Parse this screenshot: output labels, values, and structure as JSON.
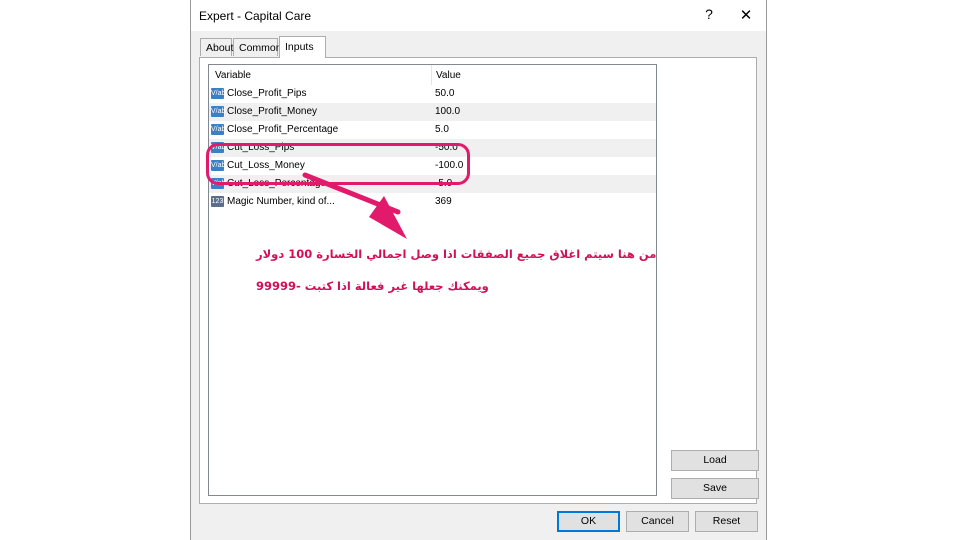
{
  "window": {
    "title": "Expert - Capital Care",
    "help": "?",
    "close": "✕"
  },
  "tabs": [
    "About",
    "Common",
    "Inputs"
  ],
  "table": {
    "col_variable": "Variable",
    "col_value": "Value",
    "rows": [
      {
        "icon": "V/ab",
        "name": "Close_Profit_Pips",
        "value": "50.0"
      },
      {
        "icon": "V/ab",
        "name": "Close_Profit_Money",
        "value": "100.0"
      },
      {
        "icon": "V/ab",
        "name": "Close_Profit_Percentage",
        "value": "5.0"
      },
      {
        "icon": "V/ab",
        "name": "Cut_Loss_Pips",
        "value": "-50.0"
      },
      {
        "icon": "V/ab",
        "name": "Cut_Loss_Money",
        "value": "-100.0"
      },
      {
        "icon": "V/ab",
        "name": "Cut_Loss_Percentage",
        "value": "-5.0"
      },
      {
        "icon": "123",
        "name": "Magic Number, kind of...",
        "value": "369"
      }
    ]
  },
  "buttons": {
    "load": "Load",
    "save": "Save",
    "ok": "OK",
    "cancel": "Cancel",
    "reset": "Reset"
  },
  "annotation": {
    "line1": "من هنا سيتم اغلاق جميع الصفقات اذا وصل اجمالي الخسارة 100 دولار",
    "line2": "ويمكنك جعلها غير فعالة اذا كتبت -99999",
    "color": "#e21a6b"
  }
}
